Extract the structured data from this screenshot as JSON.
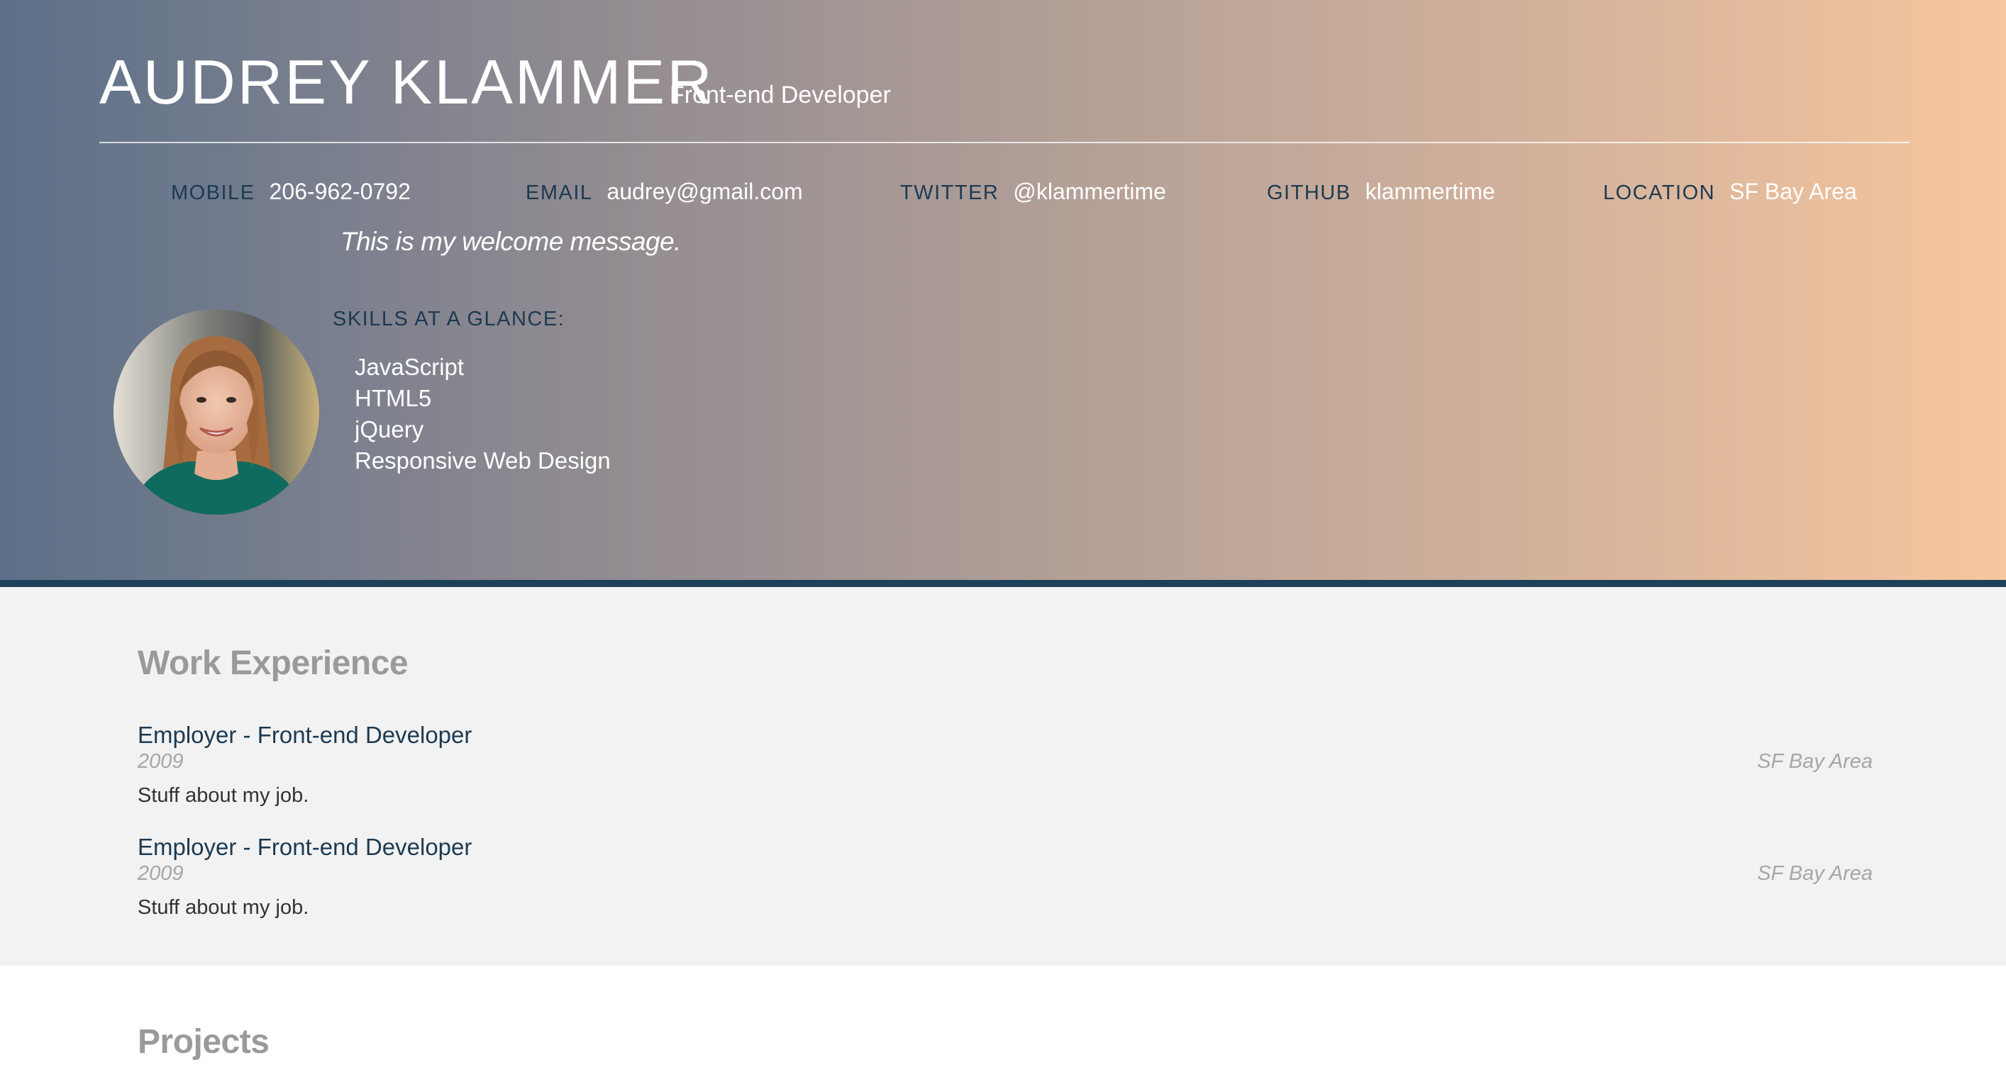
{
  "header": {
    "name": "AUDREY KLAMMER",
    "title": "Front-end Developer",
    "welcome": "This is my welcome message."
  },
  "contacts": [
    {
      "label": "MOBILE",
      "value": "206-962-0792"
    },
    {
      "label": "EMAIL",
      "value": "audrey@gmail.com"
    },
    {
      "label": "TWITTER",
      "value": "@klammertime"
    },
    {
      "label": "GITHUB",
      "value": "klammertime"
    },
    {
      "label": "LOCATION",
      "value": "SF Bay Area"
    }
  ],
  "skills": {
    "heading": "SKILLS AT A GLANCE:",
    "items": [
      "JavaScript",
      "HTML5",
      "jQuery",
      "Responsive Web Design"
    ]
  },
  "work": {
    "heading": "Work Experience",
    "jobs": [
      {
        "title": "Employer - Front-end Developer",
        "date": "2009",
        "location": "SF Bay Area",
        "description": "Stuff about my job."
      },
      {
        "title": "Employer - Front-end Developer",
        "date": "2009",
        "location": "SF Bay Area",
        "description": "Stuff about my job."
      }
    ]
  },
  "projects": {
    "heading": "Projects"
  },
  "colors": {
    "gradient_start": "#5c7089",
    "gradient_end": "#f6c79e",
    "accent_dark": "#1c3a52",
    "header_border": "#1c4159",
    "section_bg": "#f2f2f2",
    "section_heading": "#9a9a9a"
  }
}
